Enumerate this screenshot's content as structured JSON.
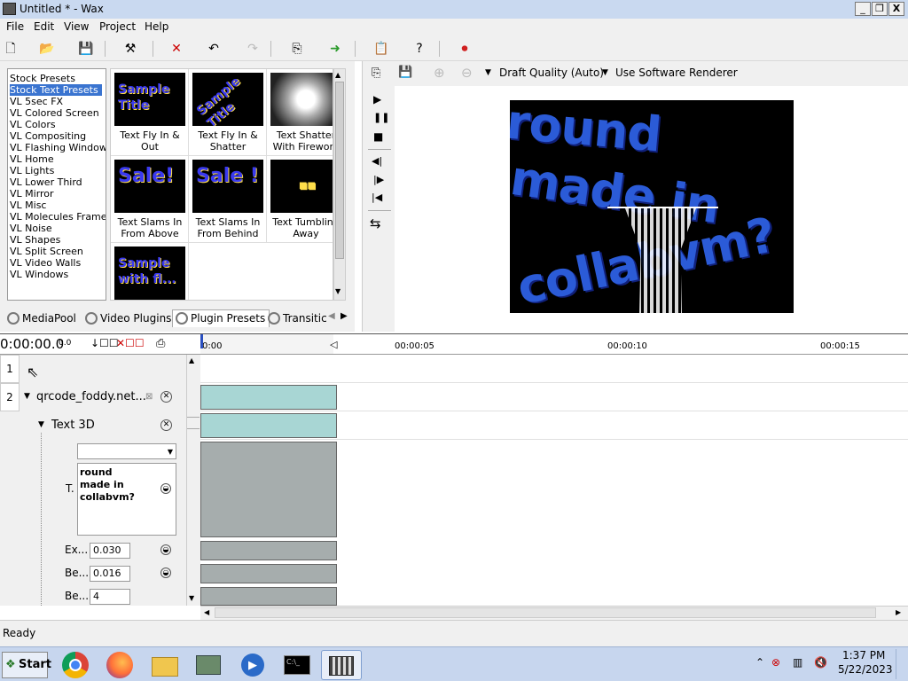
{
  "window": {
    "title": "Untitled * - Wax",
    "min": "_",
    "max": "❐",
    "close": "X"
  },
  "menu": [
    "File",
    "Edit",
    "View",
    "Project",
    "Help"
  ],
  "presets": {
    "list": [
      "Stock Presets",
      "Stock Text Presets",
      "VL 5sec FX",
      "VL Colored Screen",
      "VL Colors",
      "VL Compositing",
      "VL Flashing Windows",
      "VL Home",
      "VL Lights",
      "VL Lower Third",
      "VL Mirror",
      "VL Misc",
      "VL Molecules Frame",
      "VL Noise",
      "VL Shapes",
      "VL Split Screen",
      "VL Video Walls",
      "VL Windows"
    ],
    "selected_index": 1,
    "thumbs": [
      {
        "caption": "Text Fly In & Out",
        "art": "Sample Title"
      },
      {
        "caption": "Text Fly In & Shatter",
        "art": "Sample Title"
      },
      {
        "caption": "Text Shatter With Firework",
        "art": ""
      },
      {
        "caption": "Text Slams In From Above",
        "art": "Sale!"
      },
      {
        "caption": "Text Slams In From Behind",
        "art": "Sale !"
      },
      {
        "caption": "Text Tumbling Away",
        "art": ""
      },
      {
        "caption": "",
        "art": "Sample with fl..."
      }
    ]
  },
  "tabs": [
    "MediaPool",
    "Video Plugins",
    "Plugin Presets",
    "Transitic"
  ],
  "preview": {
    "quality": "Draft Quality (Auto)",
    "renderer": "Use Software Renderer",
    "lines": [
      "round",
      "made in",
      "collabvm?"
    ]
  },
  "timeline": {
    "timecode": "0:00:00.0",
    "small": "0.0",
    "ruler": [
      "0:00",
      "00:00:05",
      "00:00:10",
      "00:00:15"
    ],
    "track1": "1",
    "track2": "2",
    "clip_name": "qrcode_foddy.net...",
    "effect": "Text 3D",
    "text_label": "T.",
    "text_value": [
      "round",
      "made in",
      "collabvm?"
    ],
    "params": [
      {
        "label": "Ex...",
        "value": "0.030"
      },
      {
        "label": "Be...",
        "value": "0.016"
      },
      {
        "label": "Be...",
        "value": "4"
      }
    ]
  },
  "status": "Ready",
  "taskbar": {
    "start": "Start",
    "time": "1:37 PM",
    "date": "5/22/2023"
  }
}
